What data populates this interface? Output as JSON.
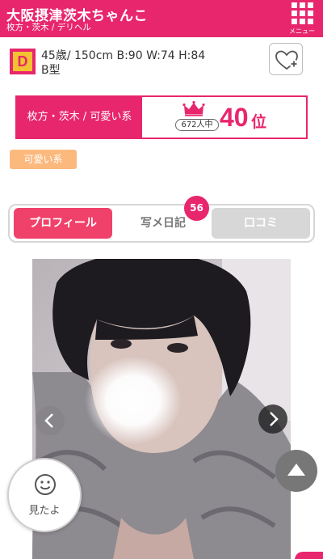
{
  "header": {
    "title": "大阪摂津茨木ちゃんこ",
    "subtitle": "枚方・茨木 / デリヘル",
    "menu_label": "メニュー",
    "menu_icon": "grid-menu-icon"
  },
  "profile": {
    "rank_letter": "D",
    "stats_line1": "45歳/ 150cm B:90 W:74 H:84",
    "stats_line2": "B型",
    "favorite_icon": "heart-plus-icon"
  },
  "ranking": {
    "area": "枚方・茨木 / 可愛い系",
    "count": "672人中",
    "rank": "40",
    "suffix": "位",
    "crown_icon": "crown-icon"
  },
  "tags": [
    "可愛い系"
  ],
  "tabs": {
    "profile": "プロフィール",
    "diary": "写メ日記",
    "diary_badge": "56",
    "review": "口コミ"
  },
  "actions": {
    "mitayo_label": "見たよ",
    "mitayo_icon": "smiley-face-icon",
    "scroll_top_icon": "triangle-up-icon",
    "prev_icon": "chevron-left-icon",
    "next_icon": "chevron-right-icon"
  },
  "colors": {
    "brand": "#e8266d",
    "tab_active": "#f0416a",
    "tag": "#fbb97e",
    "rank_gold": "#f2c230"
  }
}
